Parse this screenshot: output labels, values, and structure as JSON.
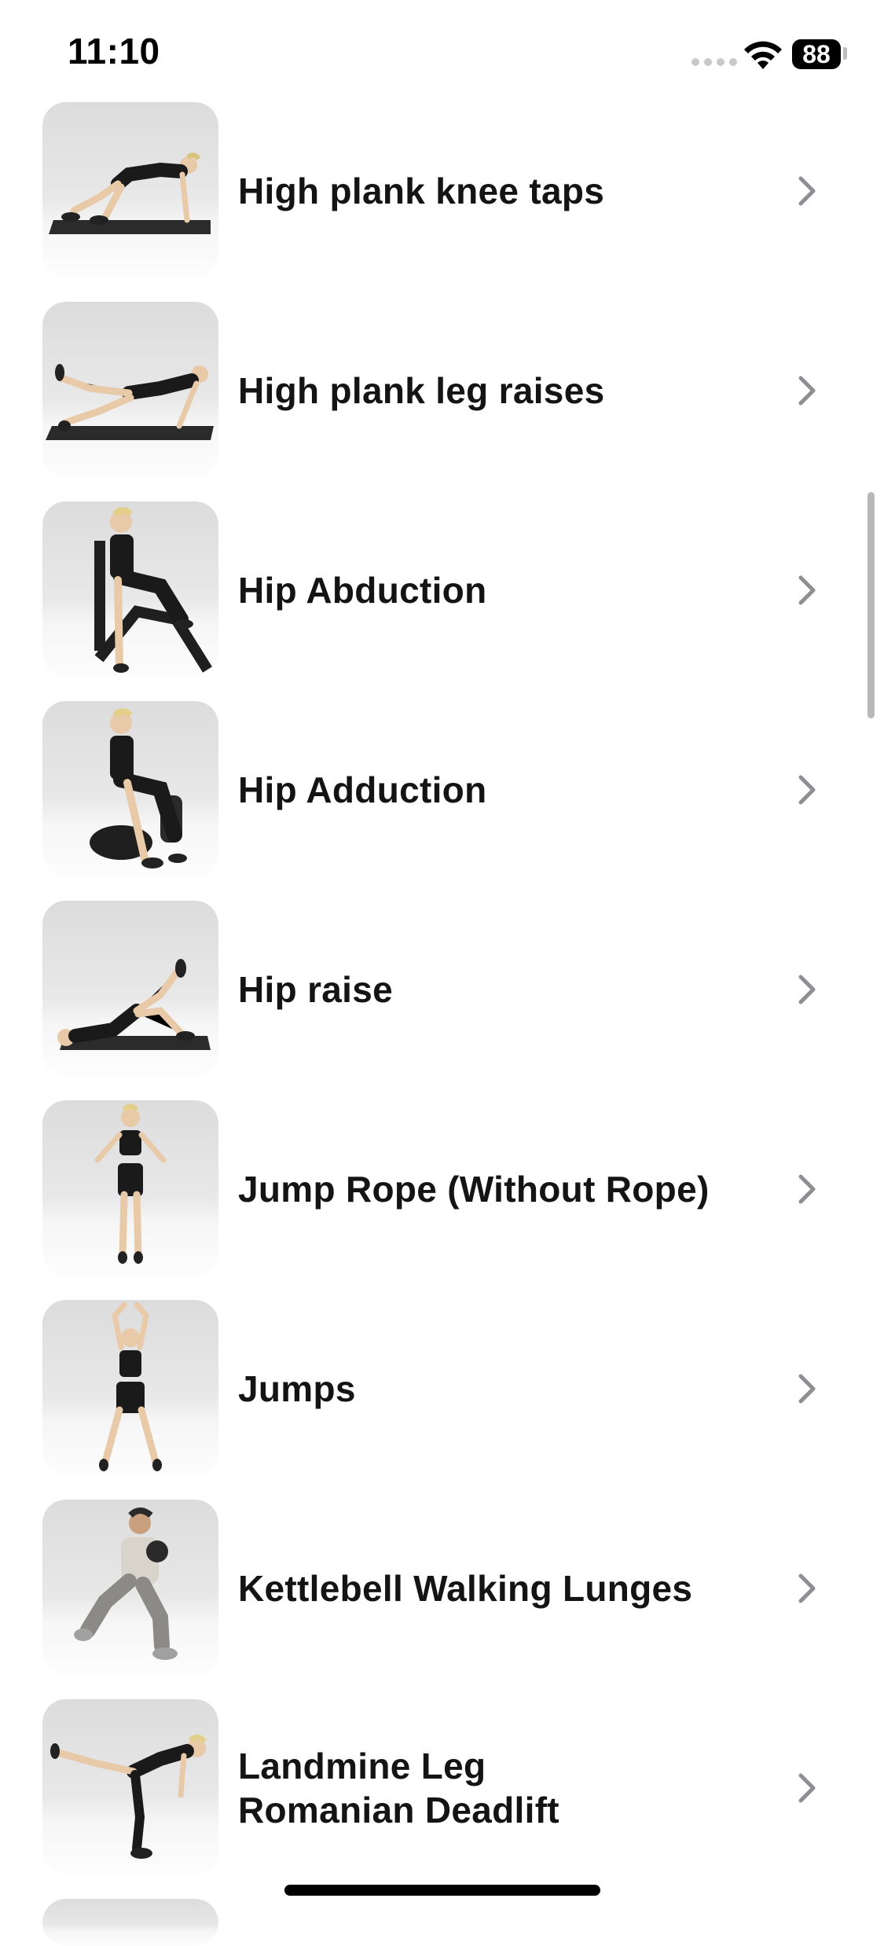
{
  "status_bar": {
    "time": "11:10",
    "battery": "88",
    "icons": [
      "signal-dots-icon",
      "wifi-icon",
      "battery-icon"
    ]
  },
  "exercises": [
    {
      "label": "High plank knee taps",
      "thumbnail": "plank-knee-tap-figure"
    },
    {
      "label": "High plank leg raises",
      "thumbnail": "plank-leg-raise-figure"
    },
    {
      "label": "Hip Abduction",
      "thumbnail": "hip-abduction-machine-figure"
    },
    {
      "label": "Hip Adduction",
      "thumbnail": "hip-adduction-machine-figure"
    },
    {
      "label": "Hip raise",
      "thumbnail": "hip-raise-figure"
    },
    {
      "label": "Jump Rope (Without Rope)",
      "thumbnail": "jump-rope-figure"
    },
    {
      "label": "Jumps",
      "thumbnail": "jumps-figure"
    },
    {
      "label": "Kettlebell Walking Lunges",
      "thumbnail": "kettlebell-lunge-figure"
    },
    {
      "label": "Landmine Leg Romanian Deadlift",
      "thumbnail": "landmine-rdl-figure"
    }
  ],
  "colors": {
    "text": "#141414",
    "chevron": "#8e8e93",
    "background": "#ffffff",
    "scroll_indicator": "#b8b8bb"
  }
}
